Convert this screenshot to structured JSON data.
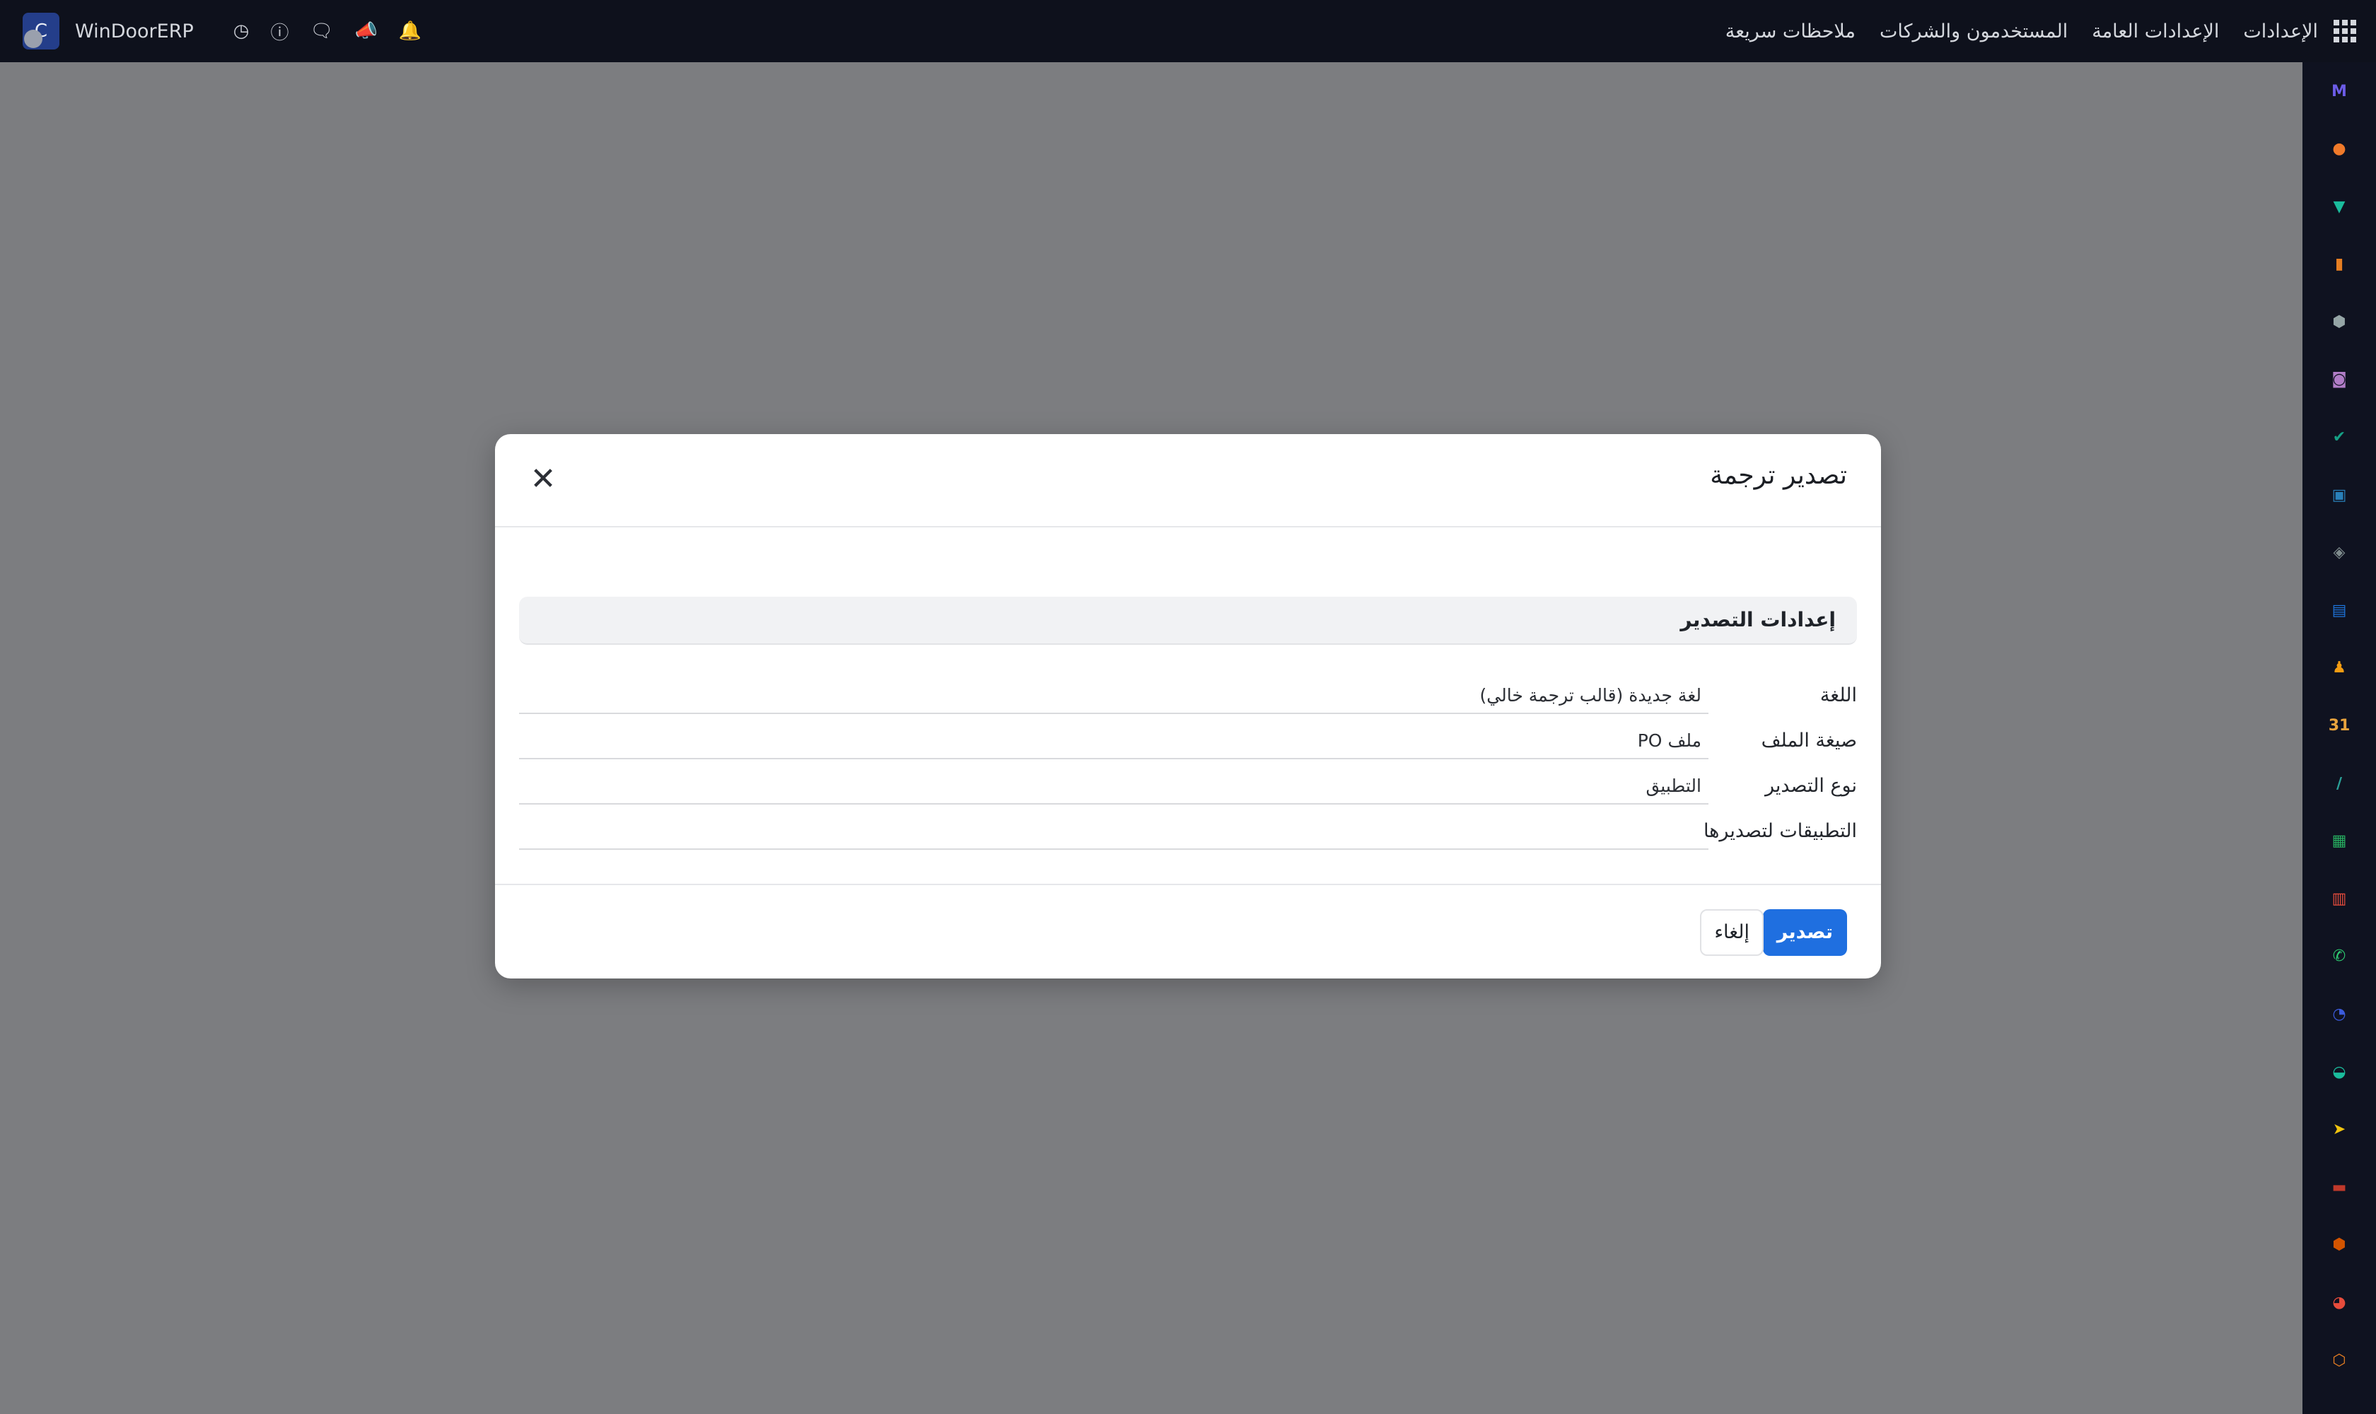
{
  "navbar": {
    "company_name": "WinDoorERP",
    "avatar_letter": "C",
    "menu": [
      "الإعدادات",
      "الإعدادات العامة",
      "المستخدمون والشركات",
      "ملاحظات سريعة"
    ],
    "icons": [
      "clock-icon",
      "help-icon",
      "chat-icon",
      "megaphone-icon",
      "bell-icon"
    ]
  },
  "rail": {
    "apps": [
      {
        "name": "mail-app",
        "color": "#6c5ce7",
        "glyph": "M"
      },
      {
        "name": "discuss-app",
        "color": "#f07a2a",
        "glyph": "●"
      },
      {
        "name": "inventory-app",
        "color": "#1abc9c",
        "glyph": "▼"
      },
      {
        "name": "reports-app",
        "color": "#e67e22",
        "glyph": "▮"
      },
      {
        "name": "modules-app",
        "color": "#95a5a6",
        "glyph": "⬢"
      },
      {
        "name": "contacts-app",
        "color": "#b07cc6",
        "glyph": "◙"
      },
      {
        "name": "tasks-app",
        "color": "#16a085",
        "glyph": "✔"
      },
      {
        "name": "board-app",
        "color": "#2980b9",
        "glyph": "▣"
      },
      {
        "name": "package-app",
        "color": "#7f8c8d",
        "glyph": "◈"
      },
      {
        "name": "documents-app",
        "color": "#1e73d8",
        "glyph": "▤"
      },
      {
        "name": "employees-app",
        "color": "#f39c12",
        "glyph": "♟"
      },
      {
        "name": "calendar-app",
        "color": "#e8a33d",
        "glyph": "31"
      },
      {
        "name": "sign-app",
        "color": "#2aa198",
        "glyph": "∕"
      },
      {
        "name": "directory-app",
        "color": "#27ae60",
        "glyph": "▦"
      },
      {
        "name": "dashboard-app",
        "color": "#e74c3c",
        "glyph": "▥"
      },
      {
        "name": "whatsapp-app",
        "color": "#2ecc71",
        "glyph": "✆"
      },
      {
        "name": "time-app",
        "color": "#3b5bdb",
        "glyph": "◔"
      },
      {
        "name": "sync-app",
        "color": "#1abc9c",
        "glyph": "◒"
      },
      {
        "name": "send-app",
        "color": "#f1c40f",
        "glyph": "➤"
      },
      {
        "name": "accounting-app",
        "color": "#c0392b",
        "glyph": "▬"
      },
      {
        "name": "cube-app",
        "color": "#d35400",
        "glyph": "⬢"
      },
      {
        "name": "pie-app",
        "color": "#e74c3c",
        "glyph": "◕"
      },
      {
        "name": "settings-app",
        "color": "#e67e22",
        "glyph": "⬡"
      }
    ]
  },
  "modal": {
    "title": "تصدير ترجمة",
    "section_title": "إعدادات التصدير",
    "fields": [
      {
        "label": "اللغة",
        "value": "لغة جديدة (قالب ترجمة خالي)"
      },
      {
        "label": "صيغة الملف",
        "value": "ملف PO"
      },
      {
        "label": "نوع التصدير",
        "value": "التطبيق"
      },
      {
        "label": "التطبيقات لتصديرها",
        "value": ""
      }
    ],
    "export_button": "تصدير",
    "cancel_button": "إلغاء"
  }
}
